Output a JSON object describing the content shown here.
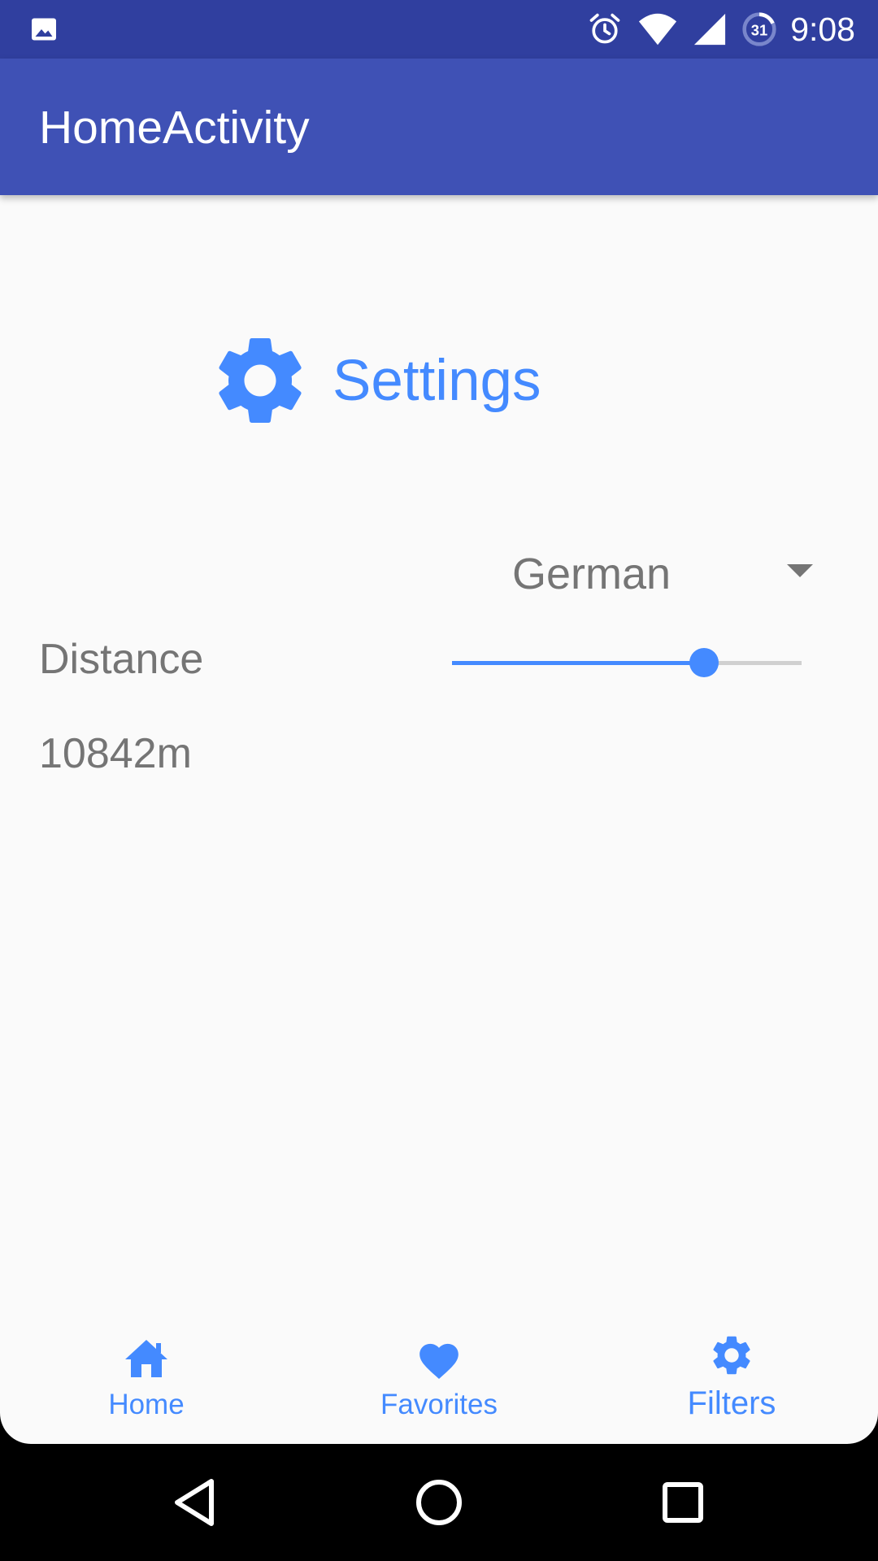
{
  "status_bar": {
    "left_icon": "image-icon",
    "icons": [
      "alarm-icon",
      "wifi-icon",
      "cell-signal-icon",
      "battery-icon"
    ],
    "battery_level": "31",
    "time": "9:08"
  },
  "app_bar": {
    "title": "HomeActivity"
  },
  "settings": {
    "icon": "gear-icon",
    "title": "Settings"
  },
  "language_select": {
    "value": "German"
  },
  "distance": {
    "label": "Distance",
    "slider_level": 0.72,
    "value": "10842m"
  },
  "bottom_nav": {
    "items": [
      {
        "label": "Home",
        "icon": "home-icon"
      },
      {
        "label": "Favorites",
        "icon": "heart-icon"
      },
      {
        "label": "Filters",
        "icon": "gear-icon",
        "active": true
      }
    ]
  },
  "system_nav": [
    "back-icon",
    "home-circle-icon",
    "recents-icon"
  ],
  "colors": {
    "primary": "#3f51b5",
    "primary_dark": "#303f9f",
    "accent": "#448aff",
    "text_secondary": "#757575",
    "background": "#fafafa"
  }
}
